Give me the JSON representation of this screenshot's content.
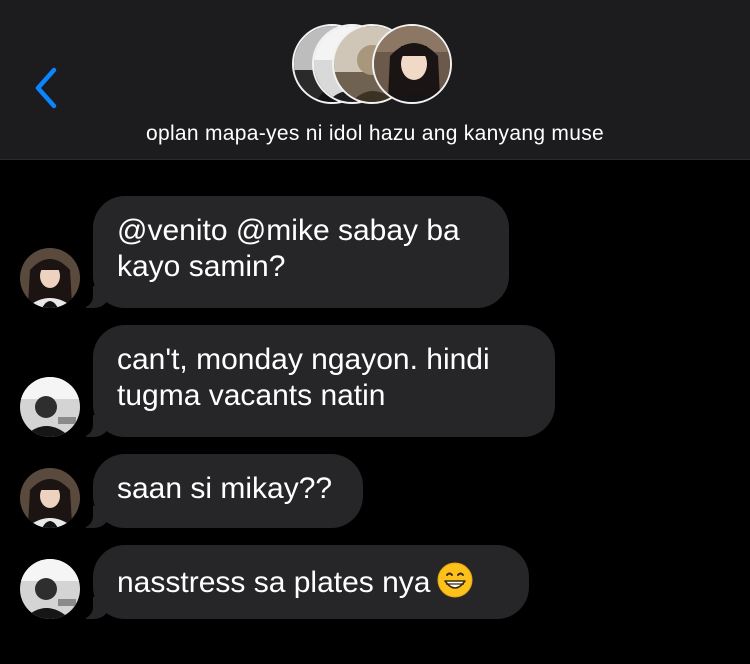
{
  "header": {
    "back_icon": "chevron-left-icon",
    "title": "oplan mapa-yes ni idol hazu ang kanyang muse",
    "accent_color": "#0a84ff"
  },
  "messages": [
    {
      "sender_avatar": "woman-long-hair-avatar",
      "text": "@venito @mike sabay ba\nkayo samin?"
    },
    {
      "sender_avatar": "bw-man-avatar",
      "text": "can't, monday ngayon. hindi\ntugma vacants natin"
    },
    {
      "sender_avatar": "woman-long-hair-avatar",
      "text": "saan si mikay??"
    },
    {
      "sender_avatar": "bw-man-avatar",
      "text": "nasstress sa plates nya",
      "emoji": "grinning-face-emoji"
    }
  ]
}
